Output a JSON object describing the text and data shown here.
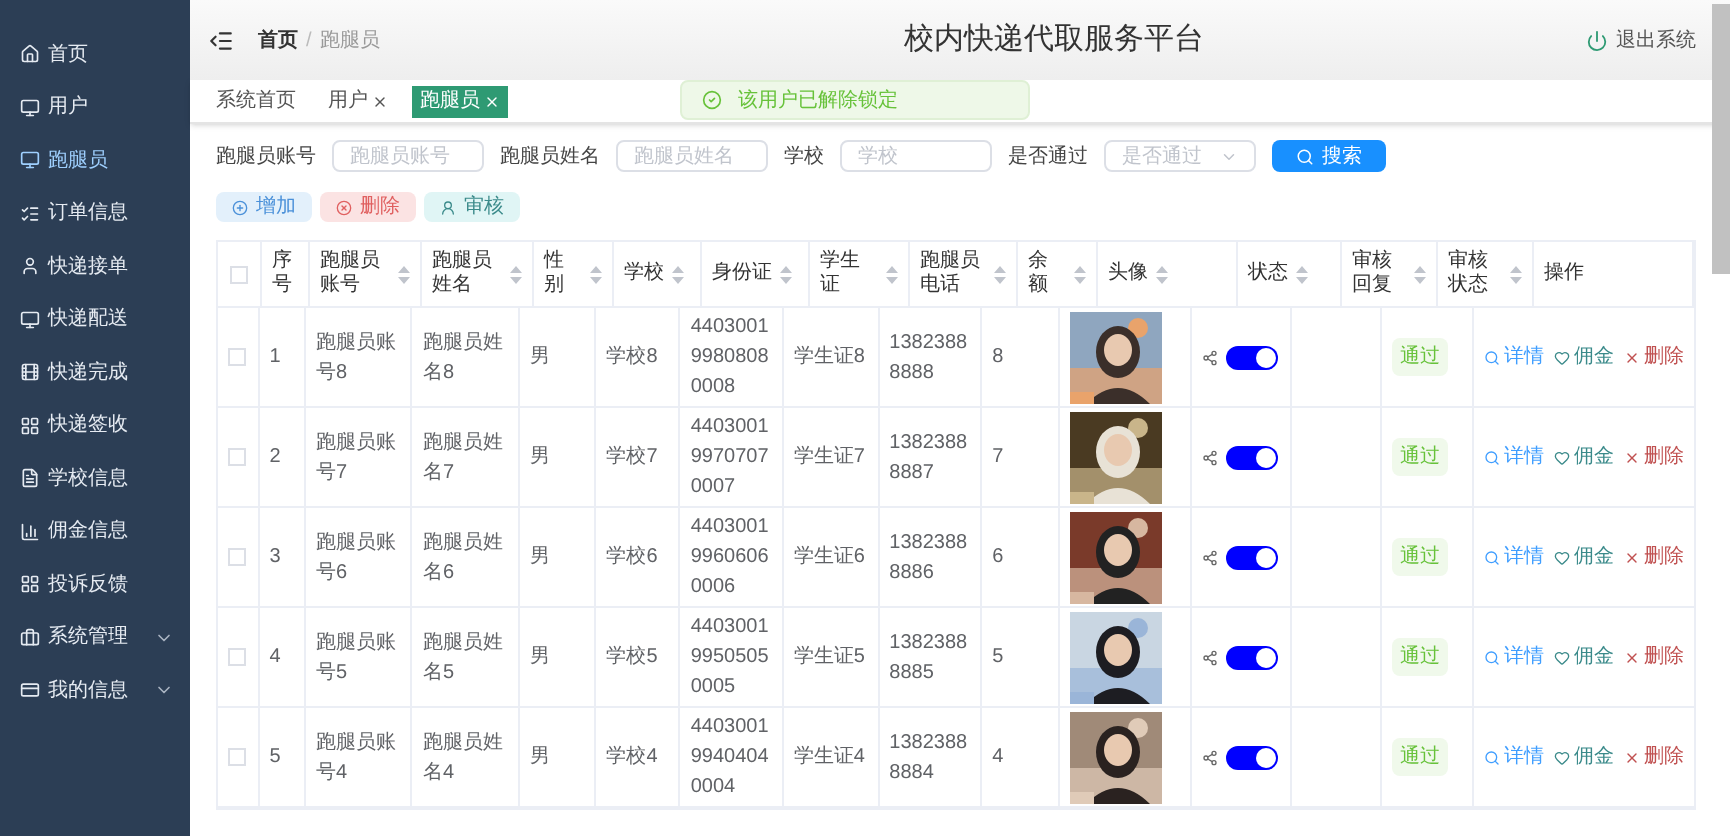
{
  "sidebar": {
    "items": [
      {
        "label": "首页",
        "selected": false
      },
      {
        "label": "用户",
        "selected": false
      },
      {
        "label": "跑腿员",
        "selected": true
      },
      {
        "label": "订单信息",
        "selected": false
      },
      {
        "label": "快递接单",
        "selected": false
      },
      {
        "label": "快递配送",
        "selected": false
      },
      {
        "label": "快递完成",
        "selected": false
      },
      {
        "label": "快递签收",
        "selected": false
      },
      {
        "label": "学校信息",
        "selected": false
      },
      {
        "label": "佣金信息",
        "selected": false
      },
      {
        "label": "投诉反馈",
        "selected": false
      },
      {
        "label": "系统管理",
        "selected": false,
        "expandable": true
      },
      {
        "label": "我的信息",
        "selected": false,
        "expandable": true
      }
    ]
  },
  "header": {
    "breadcrumb": [
      "首页",
      "跑腿员"
    ],
    "separator": "/",
    "title": "校内快递代取服务平台",
    "logout": "退出系统"
  },
  "toast": {
    "text": "该用户已解除锁定"
  },
  "tabs": [
    {
      "label": "系统首页",
      "closable": false,
      "selected": false
    },
    {
      "label": "用户",
      "closable": true,
      "selected": false
    },
    {
      "label": "跑腿员",
      "closable": true,
      "selected": true
    }
  ],
  "search": {
    "fields": [
      {
        "label": "跑腿员账号",
        "placeholder": "跑腿员账号",
        "kind": "input"
      },
      {
        "label": "跑腿员姓名",
        "placeholder": "跑腿员姓名",
        "kind": "input"
      },
      {
        "label": "学校",
        "placeholder": "学校",
        "kind": "input"
      },
      {
        "label": "是否通过",
        "placeholder": "是否通过",
        "kind": "select"
      }
    ],
    "button": "搜索"
  },
  "actions": [
    {
      "label": "增加",
      "kind": "add"
    },
    {
      "label": "删除",
      "kind": "delete"
    },
    {
      "label": "审核",
      "kind": "review"
    }
  ],
  "table": {
    "all_checked": false,
    "columns": [
      {
        "label": "序号",
        "sortable": false
      },
      {
        "label": "跑腿员账号",
        "sortable": true
      },
      {
        "label": "跑腿员姓名",
        "sortable": true
      },
      {
        "label": "性别",
        "sortable": true
      },
      {
        "label": "学校",
        "sortable": true
      },
      {
        "label": "身份证",
        "sortable": true
      },
      {
        "label": "学生证",
        "sortable": true
      },
      {
        "label": "跑腿员电话",
        "sortable": true
      },
      {
        "label": "余额",
        "sortable": true
      },
      {
        "label": "头像",
        "sortable": true
      },
      {
        "label": "状态",
        "sortable": true
      },
      {
        "label": "审核回复",
        "sortable": true
      },
      {
        "label": "审核状态",
        "sortable": true
      },
      {
        "label": "操作",
        "sortable": false
      }
    ],
    "rows": [
      {
        "checked": false,
        "cells": [
          "1",
          "跑腿员账号8",
          "跑腿员姓名8",
          "男",
          "学校8",
          "440300199808080008",
          "学生证8",
          "13823888888",
          "8"
        ],
        "on": true,
        "status": "通过",
        "ops": [
          "详情",
          "佣金",
          "删除"
        ]
      },
      {
        "checked": false,
        "cells": [
          "2",
          "跑腿员账号7",
          "跑腿员姓名7",
          "男",
          "学校7",
          "440300199707070007",
          "学生证7",
          "13823888887",
          "7"
        ],
        "on": true,
        "status": "通过",
        "ops": [
          "详情",
          "佣金",
          "删除"
        ]
      },
      {
        "checked": false,
        "cells": [
          "3",
          "跑腿员账号6",
          "跑腿员姓名6",
          "男",
          "学校6",
          "440300199606060006",
          "学生证6",
          "13823888886",
          "6"
        ],
        "on": true,
        "status": "通过",
        "ops": [
          "详情",
          "佣金",
          "删除"
        ]
      },
      {
        "checked": false,
        "cells": [
          "4",
          "跑腿员账号5",
          "跑腿员姓名5",
          "男",
          "学校5",
          "440300199505050005",
          "学生证5",
          "13823888885",
          "5"
        ],
        "on": true,
        "status": "通过",
        "ops": [
          "详情",
          "佣金",
          "删除"
        ]
      },
      {
        "checked": false,
        "cells": [
          "5",
          "跑腿员账号4",
          "跑腿员姓名4",
          "男",
          "学校4",
          "440300199404040004",
          "学生证4",
          "13823888884",
          "4"
        ],
        "on": true,
        "status": "通过",
        "ops": [
          "详情",
          "佣金",
          "删除"
        ]
      }
    ]
  }
}
